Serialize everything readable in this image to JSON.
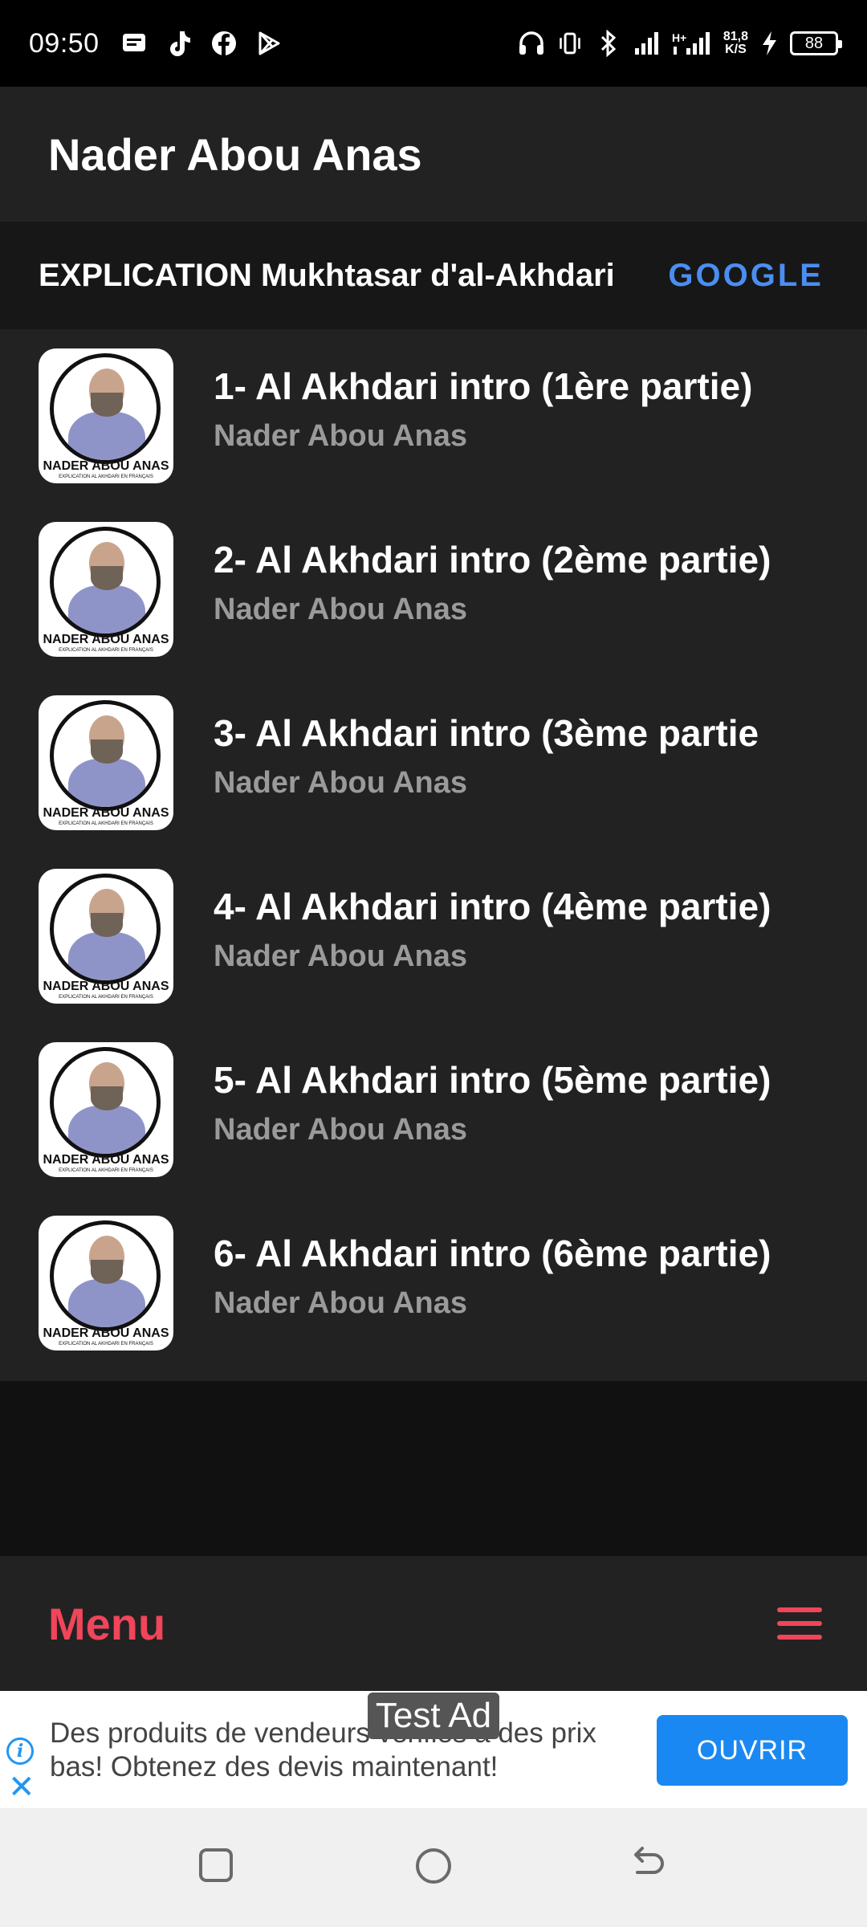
{
  "status_bar": {
    "time": "09:50",
    "net_speed_value": "81,8",
    "net_speed_unit": "K/S",
    "network_type": "H+",
    "battery": "88",
    "left_icons": [
      "message-icon",
      "tiktok-icon",
      "facebook-icon",
      "play-store-icon"
    ],
    "right_icons": [
      "headphones-icon",
      "vibrate-icon",
      "bluetooth-icon",
      "signal-icon",
      "signal-icon",
      "charging-icon"
    ]
  },
  "app_bar": {
    "title": "Nader Abou Anas"
  },
  "sub_header": {
    "title": "EXPLICATION Mukhtasar d'al-Akhdari",
    "link": "GOOGLE",
    "link_color": "#4a8ef2"
  },
  "thumbnail": {
    "label": "NADER ABOU ANAS",
    "sublabel": "EXPLICATION AL AKHDARI EN FRANÇAIS"
  },
  "tracks": [
    {
      "title": "1- Al Akhdari intro (1ère partie)",
      "artist": "Nader Abou Anas"
    },
    {
      "title": "2- Al Akhdari intro (2ème partie)",
      "artist": "Nader Abou Anas"
    },
    {
      "title": "3- Al Akhdari intro (3ème partie",
      "artist": "Nader Abou Anas"
    },
    {
      "title": "4- Al Akhdari intro (4ème partie)",
      "artist": "Nader Abou Anas"
    },
    {
      "title": "5- Al Akhdari intro (5ème partie)",
      "artist": "Nader Abou Anas"
    },
    {
      "title": "6- Al Akhdari intro (6ème partie)",
      "artist": "Nader Abou Anas"
    }
  ],
  "menu_bar": {
    "label": "Menu",
    "accent_color": "#f0455a"
  },
  "ad": {
    "badge": "Test Ad",
    "text": "Des produits de vendeurs vérifiés à des prix bas! Obtenez des devis maintenant!",
    "button": "OUVRIR",
    "button_color": "#1a88f2"
  }
}
